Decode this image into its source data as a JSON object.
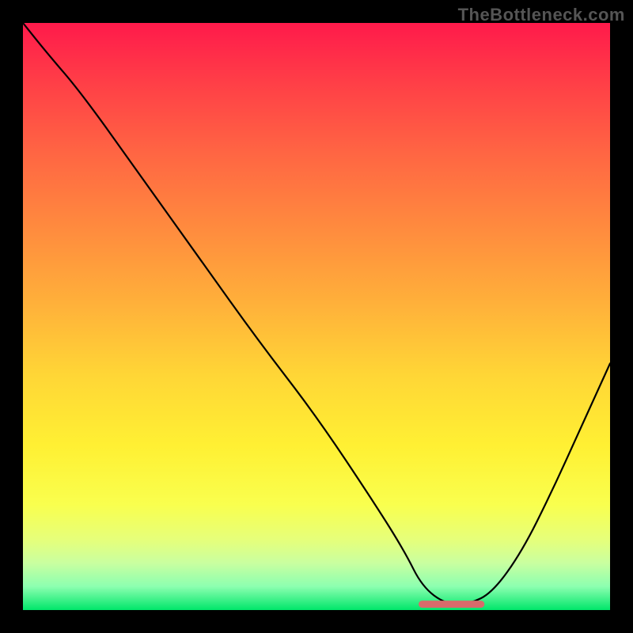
{
  "watermark": "TheBottleneck.com",
  "chart_data": {
    "type": "line",
    "title": "",
    "xlabel": "",
    "ylabel": "",
    "xlim": [
      0,
      100
    ],
    "ylim": [
      0,
      100
    ],
    "x": [
      0,
      4,
      10,
      20,
      30,
      40,
      50,
      60,
      65,
      68,
      72,
      76,
      80,
      85,
      90,
      95,
      100
    ],
    "values": [
      100,
      95,
      88,
      74,
      60,
      46,
      33,
      18,
      10,
      4,
      1,
      1,
      3,
      10,
      20,
      31,
      42
    ],
    "optimal_zone": {
      "x_start": 68,
      "x_end": 78,
      "y": 1
    },
    "gradient_stops": [
      {
        "pos": 0,
        "color": "#ff1a4b"
      },
      {
        "pos": 50,
        "color": "#ffcc33"
      },
      {
        "pos": 85,
        "color": "#f5ff55"
      },
      {
        "pos": 100,
        "color": "#00e66a"
      }
    ]
  }
}
